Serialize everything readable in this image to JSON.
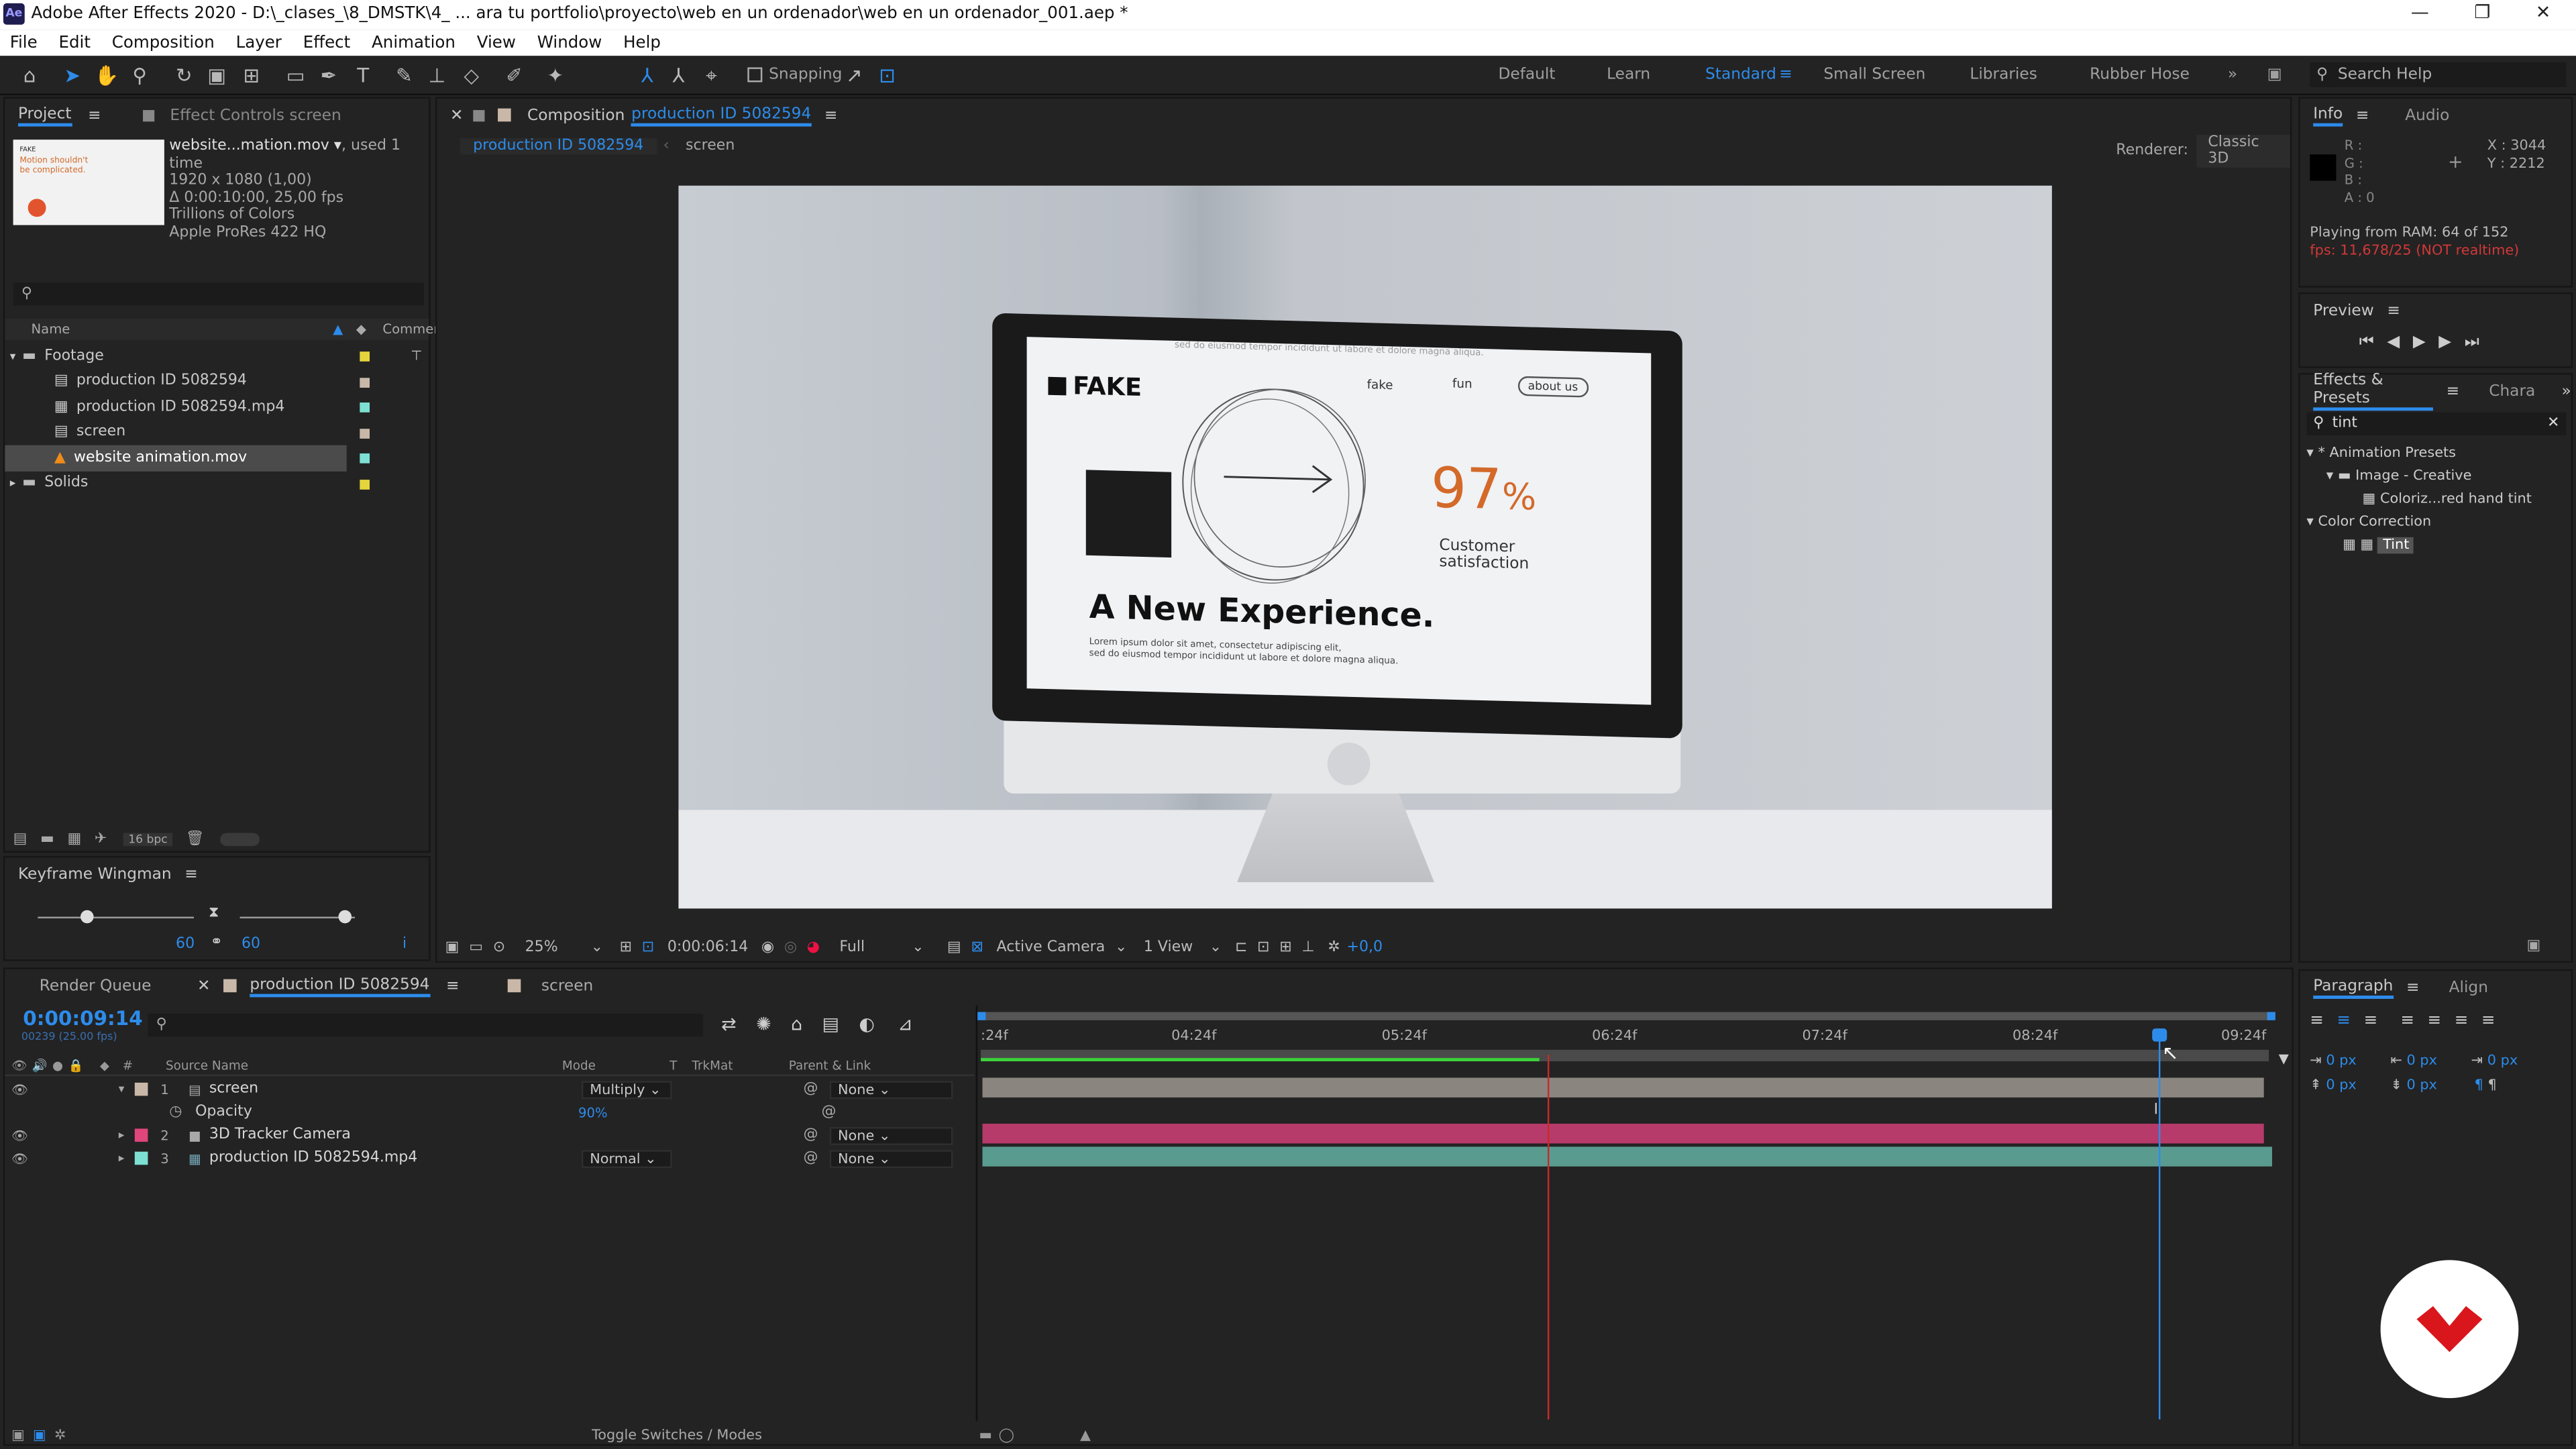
{
  "app": {
    "title": "Adobe After Effects 2020 - D:\\_clases_\\8_DMSTK\\4_ ... ara tu portfolio\\proyecto\\web en un ordenador\\web en un ordenador_001.aep *",
    "logo": "Ae"
  },
  "menu": [
    "File",
    "Edit",
    "Composition",
    "Layer",
    "Effect",
    "Animation",
    "View",
    "Window",
    "Help"
  ],
  "toolbar": {
    "snapping": "Snapping"
  },
  "workspaces": [
    "Default",
    "Learn",
    "Standard",
    "Small Screen",
    "Libraries",
    "Rubber Hose"
  ],
  "search_help": "Search Help",
  "project": {
    "tab": "Project",
    "effect_controls_tab": "Effect Controls screen",
    "file_name": "website...mation.mov",
    "used": ", used 1 time",
    "size": "1920 x 1080 (1,00)",
    "duration": "Δ 0:00:10:00, 25,00 fps",
    "colors": "Trillions of Colors",
    "codec": "Apple ProRes 422 HQ",
    "thumb_heading": "Motion shouldn't be complicated.",
    "thumb_brand": "FAKE",
    "search_placeholder": "",
    "col_name": "Name",
    "col_comment": "Commen",
    "items": [
      {
        "name": "Footage",
        "type": "folder",
        "color": "#e5d53d"
      },
      {
        "name": "production ID 5082594",
        "type": "comp",
        "color": "#c9b8a8"
      },
      {
        "name": "production ID 5082594.mp4",
        "type": "video",
        "color": "#7de0d3"
      },
      {
        "name": "screen",
        "type": "comp",
        "color": "#c9b8a8"
      },
      {
        "name": "website animation.mov",
        "type": "vlc",
        "color": "#7de0d3"
      },
      {
        "name": "Solids",
        "type": "folder",
        "color": "#e5d53d"
      }
    ],
    "bpc": "16 bpc"
  },
  "wingman": {
    "title": "Keyframe Wingman",
    "val1": "60",
    "val2": "60"
  },
  "comp": {
    "label": "Composition",
    "name": "production ID 5082594",
    "breadcrumb1": "production ID 5082594",
    "breadcrumb2": "screen",
    "renderer_label": "Renderer:",
    "renderer": "Classic 3D",
    "zoom": "25%",
    "time": "0:00:06:14",
    "quality": "Full",
    "camera": "Active Camera",
    "view": "1 View",
    "exposure": "+0,0"
  },
  "screen": {
    "brand": "FAKE",
    "nav1": "fake",
    "nav2": "fun",
    "nav3": "about us",
    "percent": "97",
    "percent_sign": "%",
    "stat1": "Customer",
    "stat2": "satisfaction",
    "headline": "A New Experience.",
    "lorem1": "Lorem ipsum dolor sit amet, consectetur adipiscing elit,",
    "lorem2": "sed do eiusmod tempor incididunt ut labore et dolore magna aliqua.",
    "top_lorem": "sed do eiusmod tempor incididunt ut labore et dolore magna aliqua."
  },
  "info": {
    "tab": "Info",
    "audio_tab": "Audio",
    "r": "R :",
    "g": "G :",
    "b": "B :",
    "a": "A : 0",
    "x": "X : 3044",
    "y": "Y : 2212",
    "playing": "Playing from RAM: 64 of 152",
    "fps": "fps: 11,678/25 (NOT realtime)"
  },
  "preview": {
    "title": "Preview"
  },
  "effects": {
    "title": "Effects & Presets",
    "chara": "Chara",
    "search": "tint",
    "anim_presets": "* Animation Presets",
    "image_creative": "Image - Creative",
    "coloriz": "Coloriz...red hand tint",
    "color_corr": "Color Correction",
    "tint": "Tint"
  },
  "paragraph": {
    "title": "Paragraph",
    "align": "Align",
    "px": "0 px"
  },
  "timeline": {
    "render_queue": "Render Queue",
    "comp_tab": "production ID 5082594",
    "screen_tab": "screen",
    "timecode": "0:00:09:14",
    "frames": "00239 (25.00 fps)",
    "col_source": "Source Name",
    "col_mode": "Mode",
    "col_t": "T",
    "col_trkmat": "TrkMat",
    "col_parent": "Parent & Link",
    "ruler": [
      ":24f",
      "04:24f",
      "05:24f",
      "06:24f",
      "07:24f",
      "08:24f",
      "09:24f"
    ],
    "layers": [
      {
        "num": "1",
        "name": "screen",
        "mode": "Multiply",
        "parent": "None",
        "color": "#c9b8a8",
        "icon": "comp"
      },
      {
        "num": "2",
        "name": "3D Tracker Camera",
        "mode": "",
        "parent": "None",
        "color": "#e0457b",
        "icon": "camera"
      },
      {
        "num": "3",
        "name": "production ID 5082594.mp4",
        "mode": "Normal",
        "parent": "None",
        "color": "#7de0d3",
        "icon": "video"
      }
    ],
    "opacity_label": "Opacity",
    "opacity_val": "90",
    "opacity_unit": "%",
    "toggle": "Toggle Switches / Modes"
  }
}
